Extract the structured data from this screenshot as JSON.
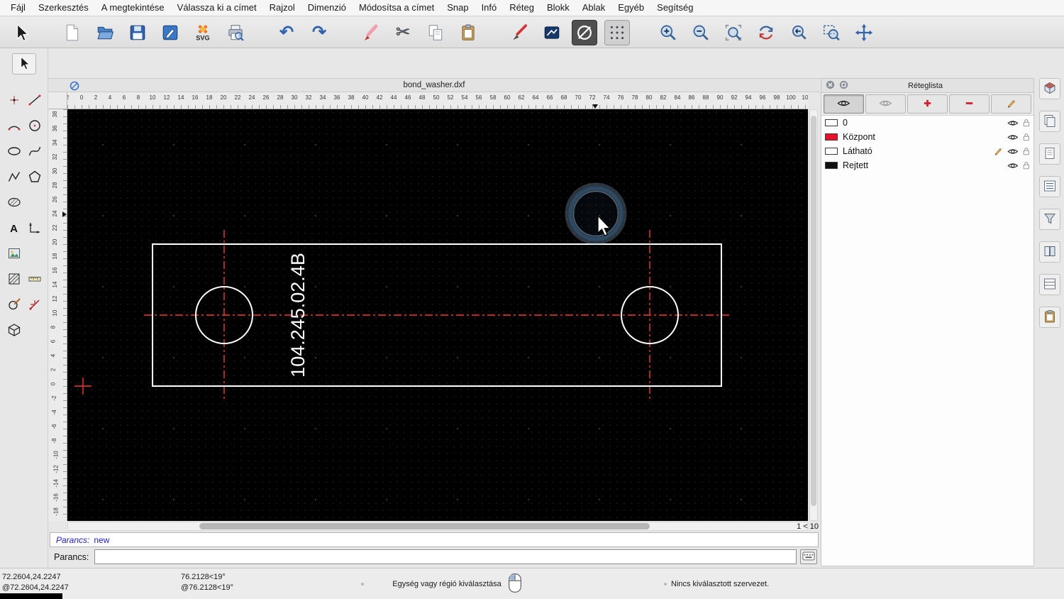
{
  "menubar": {
    "items": [
      {
        "id": "fajl",
        "label": "Fájl"
      },
      {
        "id": "szerkesztes",
        "label": "Szerkesztés"
      },
      {
        "id": "megtekintes",
        "label": "A megtekintése"
      },
      {
        "id": "kivalasztas",
        "label": "Válassza ki a címet"
      },
      {
        "id": "rajzol",
        "label": "Rajzol"
      },
      {
        "id": "dimenzio",
        "label": "Dimenzió"
      },
      {
        "id": "modositas",
        "label": "Módosítsa a címet"
      },
      {
        "id": "snap",
        "label": "Snap"
      },
      {
        "id": "info",
        "label": "Infó"
      },
      {
        "id": "reteg",
        "label": "Réteg"
      },
      {
        "id": "blokk",
        "label": "Blokk"
      },
      {
        "id": "ablak",
        "label": "Ablak"
      },
      {
        "id": "egyeb",
        "label": "Egyéb"
      },
      {
        "id": "segitseg",
        "label": "Segítség"
      }
    ]
  },
  "toolbar": {
    "groups": [
      [
        {
          "id": "select",
          "icon": "cursor"
        }
      ],
      [
        {
          "id": "new",
          "icon": "new"
        },
        {
          "id": "open",
          "icon": "open"
        },
        {
          "id": "save",
          "icon": "save"
        },
        {
          "id": "edit-drawing",
          "icon": "editdwg"
        },
        {
          "id": "export-svg",
          "icon": "svgexp"
        },
        {
          "id": "print-preview",
          "icon": "print"
        }
      ],
      [
        {
          "id": "undo",
          "icon": "undo"
        },
        {
          "id": "redo",
          "icon": "redo"
        }
      ],
      [
        {
          "id": "delete",
          "icon": "eraser"
        },
        {
          "id": "cut",
          "icon": "cut"
        },
        {
          "id": "copy",
          "icon": "copy"
        },
        {
          "id": "paste",
          "icon": "paste"
        }
      ],
      [
        {
          "id": "pen",
          "icon": "pen"
        },
        {
          "id": "attributes",
          "icon": "attributes"
        },
        {
          "id": "ellipse-tool",
          "icon": "ellipsetool",
          "pressed": true,
          "dark": true
        },
        {
          "id": "snap-grid",
          "icon": "gridsnap",
          "pressed": true
        }
      ],
      [
        {
          "id": "zoom-in",
          "icon": "zoomin"
        },
        {
          "id": "zoom-out",
          "icon": "zoomout"
        },
        {
          "id": "zoom-auto",
          "icon": "zoomauto"
        },
        {
          "id": "zoom-redraw",
          "icon": "zoomredraw"
        },
        {
          "id": "zoom-previous",
          "icon": "zoomprev"
        },
        {
          "id": "zoom-window",
          "icon": "zoomwindow"
        },
        {
          "id": "zoom-pan",
          "icon": "pan"
        }
      ]
    ]
  },
  "left_tools": {
    "items": [
      {
        "id": "point",
        "icon": "point"
      },
      {
        "id": "line",
        "icon": "line"
      },
      {
        "id": "arc",
        "icon": "arc"
      },
      {
        "id": "circle",
        "icon": "circle"
      },
      {
        "id": "ellipse",
        "icon": "ellipse"
      },
      {
        "id": "spline",
        "icon": "spline"
      },
      {
        "id": "polyline",
        "icon": "polyline"
      },
      {
        "id": "polygon",
        "icon": "polygon"
      },
      {
        "id": "region",
        "icon": "region"
      },
      {
        "id": "",
        "icon": ""
      },
      {
        "id": "text",
        "icon": "text"
      },
      {
        "id": "dimension",
        "icon": "dimension"
      },
      {
        "id": "image",
        "icon": "image"
      },
      {
        "id": "",
        "icon": ""
      },
      {
        "id": "hatch",
        "icon": "hatch"
      },
      {
        "id": "measure",
        "icon": "measure"
      },
      {
        "id": "modify",
        "icon": "modify"
      },
      {
        "id": "info",
        "icon": "info"
      },
      {
        "id": "block",
        "icon": "block"
      },
      {
        "id": "",
        "icon": ""
      }
    ]
  },
  "document": {
    "title": "bond_washer.dxf",
    "part_label": "104.245.02.4B",
    "page_indicator": "1 < 10"
  },
  "rulers": {
    "horizontal": [
      "2",
      "0",
      "2",
      "4",
      "6",
      "8",
      "10",
      "12",
      "14",
      "16",
      "18",
      "20",
      "22",
      "24",
      "26",
      "28",
      "30",
      "32",
      "34",
      "36",
      "38",
      "40",
      "42",
      "44",
      "46",
      "48",
      "50",
      "52",
      "54",
      "56",
      "58",
      "60",
      "62",
      "64",
      "66",
      "68",
      "70",
      "72",
      "74",
      "76",
      "78",
      "80",
      "82",
      "84",
      "86",
      "88",
      "90",
      "92",
      "94",
      "96",
      "98",
      "100",
      "10"
    ],
    "vertical": [
      "38",
      "36",
      "34",
      "32",
      "30",
      "28",
      "26",
      "24",
      "22",
      "20",
      "18",
      "16",
      "14",
      "12",
      "10",
      "8",
      "6",
      "4",
      "2",
      "0",
      "-2",
      "-4",
      "-6",
      "-8",
      "-10",
      "-12",
      "-14",
      "-16",
      "-18"
    ]
  },
  "command": {
    "history_label": "Parancs:",
    "history_value": "new",
    "prompt_label": "Parancs:"
  },
  "layer_panel": {
    "title": "Réteglista",
    "toolbar": [
      {
        "id": "show-all-layers",
        "icon": "eye",
        "checked": true
      },
      {
        "id": "show-inactive-layers",
        "icon": "eyegray"
      },
      {
        "id": "add-layer",
        "icon": "plus"
      },
      {
        "id": "remove-layer",
        "icon": "minus"
      },
      {
        "id": "edit-layer",
        "icon": "pencil"
      }
    ],
    "layers": [
      {
        "id": "0",
        "name": "0",
        "color": "#ffffff"
      },
      {
        "id": "kozpont",
        "name": "Központ",
        "color": "#e8112d"
      },
      {
        "id": "lathato",
        "name": "Látható",
        "color": "#ffffff",
        "current": true
      },
      {
        "id": "rejtett",
        "name": "Rejtett",
        "color": "#111111"
      }
    ]
  },
  "right_dock": {
    "items": [
      {
        "id": "block-widget",
        "icon": "cube"
      },
      {
        "id": "pages-widget",
        "icon": "pages"
      },
      {
        "id": "page-widget",
        "icon": "page"
      },
      {
        "id": "list-widget",
        "icon": "list"
      },
      {
        "id": "filter-widget",
        "icon": "filter"
      },
      {
        "id": "library-widget",
        "icon": "book"
      },
      {
        "id": "rows-widget",
        "icon": "rows"
      },
      {
        "id": "clipboard-widget",
        "icon": "clipboard"
      }
    ]
  },
  "status_bar": {
    "abs_coord": "72.2604,24.2247",
    "rel_coord": "@72.2604,24.2247",
    "abs_polar": "76.2128<19°",
    "rel_polar": "@76.2128<19°",
    "hint": "Egység vagy régió kiválasztása",
    "selection": "Nincs kiválasztott szervezet."
  }
}
